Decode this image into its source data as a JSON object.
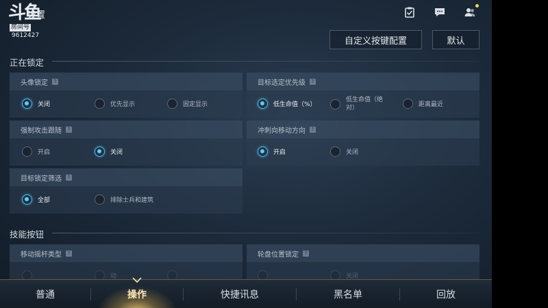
{
  "header": {
    "logo_text": "斗鱼",
    "title": "设置",
    "room_label": "房间号",
    "room_id": "9612427"
  },
  "top_icons": [
    "task-check-icon",
    "chat-bubble-icon",
    "friends-icon"
  ],
  "actions": {
    "custom_keys": "自定义按键配置",
    "default": "默认"
  },
  "sections": {
    "locking": "正在锁定",
    "skill_buttons": "技能按钮"
  },
  "cards": {
    "avatar_lock": {
      "title": "头像锁定",
      "options": [
        "关闭",
        "优先显示",
        "固定显示"
      ],
      "selected": 0
    },
    "target_priority": {
      "title": "目标选定优先级",
      "options": [
        "低生命值（%）",
        "低生命值（绝对）",
        "距离最近"
      ],
      "selected": 0
    },
    "force_follow": {
      "title": "强制攻击跟随",
      "options": [
        "开启",
        "关闭"
      ],
      "selected": 1
    },
    "dash_direction": {
      "title": "冲刺向移动方向",
      "options": [
        "开启",
        "关闭"
      ],
      "selected": 0
    },
    "target_filter": {
      "title": "目标锁定筛选",
      "options": [
        "全部",
        "排除士兵和建筑"
      ],
      "selected": 0
    },
    "joystick_type": {
      "title": "移动摇杆类型",
      "options": [
        "",
        "动",
        ""
      ]
    },
    "wheel_lock": {
      "title": "轮盘位置锁定",
      "options": [
        "",
        "关闭"
      ]
    }
  },
  "nav": {
    "items": [
      "普通",
      "操作",
      "快捷讯息",
      "黑名单",
      "回放"
    ],
    "active": 1
  },
  "colors": {
    "accent": "#58b6e6",
    "gold": "#f2d46a"
  }
}
